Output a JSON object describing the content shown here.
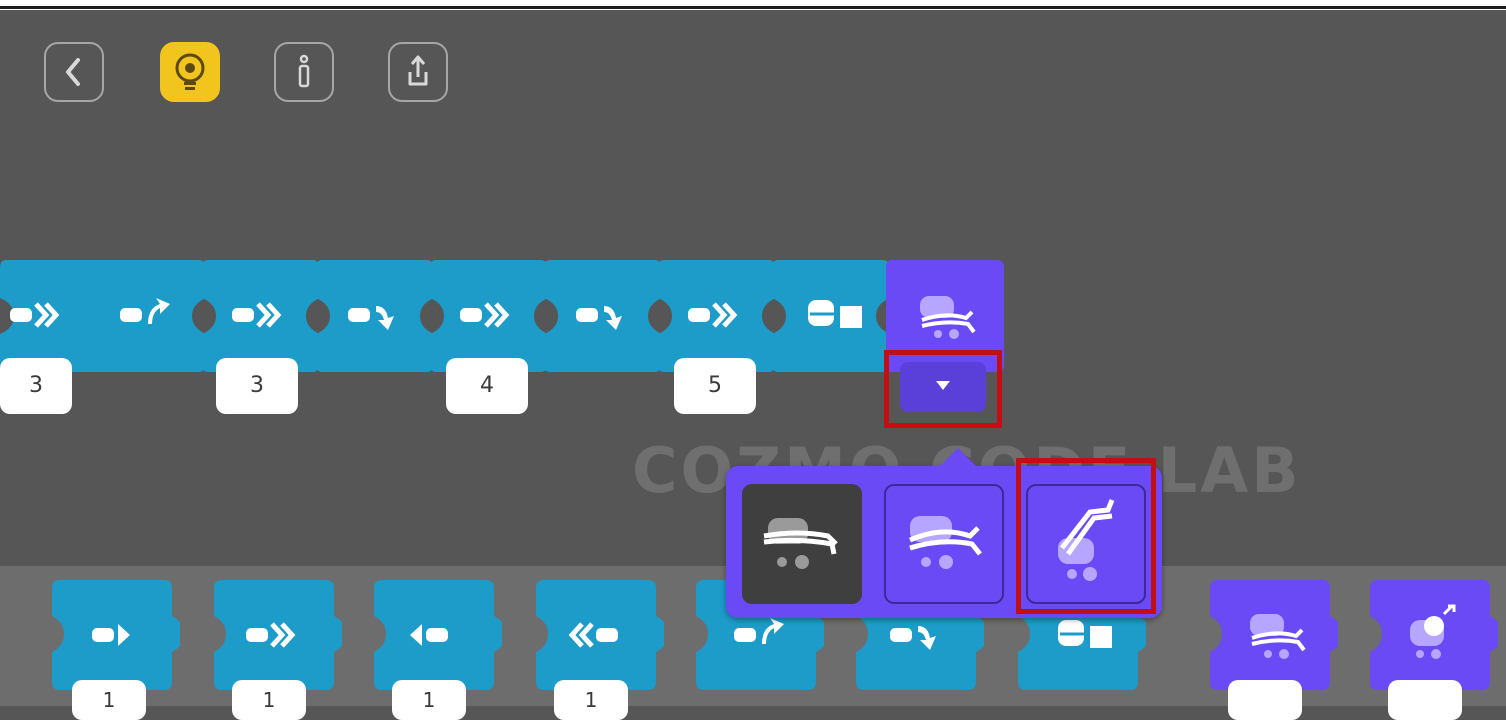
{
  "toolbar": {
    "buttons": [
      {
        "icon": "back-icon"
      },
      {
        "icon": "lightbulb-gear-icon"
      },
      {
        "icon": "info-icon"
      },
      {
        "icon": "share-icon"
      }
    ]
  },
  "colors": {
    "background": "#575657",
    "tray": "#6e6d6e",
    "motion_block": "#1d9bc9",
    "lift_block": "#6a4af4",
    "hint_button": "#f2c51e",
    "highlight": "#c30f14"
  },
  "watermark": "COZMO CODE LAB",
  "program": {
    "blocks": [
      {
        "icon": "drive-forward-fast-icon",
        "value": "3"
      },
      {
        "icon": "turn-left-icon"
      },
      {
        "icon": "drive-forward-fast-icon",
        "value": "3"
      },
      {
        "icon": "turn-right-icon"
      },
      {
        "icon": "drive-forward-fast-icon",
        "value": "4"
      },
      {
        "icon": "turn-right-icon"
      },
      {
        "icon": "drive-forward-fast-icon",
        "value": "5"
      },
      {
        "icon": "lift-cube-icon"
      },
      {
        "icon": "lift-middle-icon"
      }
    ]
  },
  "lift_options": [
    {
      "icon": "lift-down-icon",
      "selected": true
    },
    {
      "icon": "lift-middle-icon",
      "selected": false
    },
    {
      "icon": "lift-up-icon",
      "selected": false
    }
  ],
  "tray": {
    "blocks": [
      {
        "icon": "drive-forward-icon",
        "value": "1"
      },
      {
        "icon": "drive-forward-fast-icon",
        "value": "1"
      },
      {
        "icon": "drive-backward-icon",
        "value": "1"
      },
      {
        "icon": "drive-backward-fast-icon",
        "value": "1"
      },
      {
        "icon": "turn-left-icon"
      },
      {
        "icon": "turn-right-icon"
      },
      {
        "icon": "lift-cube-icon"
      },
      {
        "icon": "lift-middle-icon"
      },
      {
        "icon": "head-up-icon"
      }
    ]
  }
}
